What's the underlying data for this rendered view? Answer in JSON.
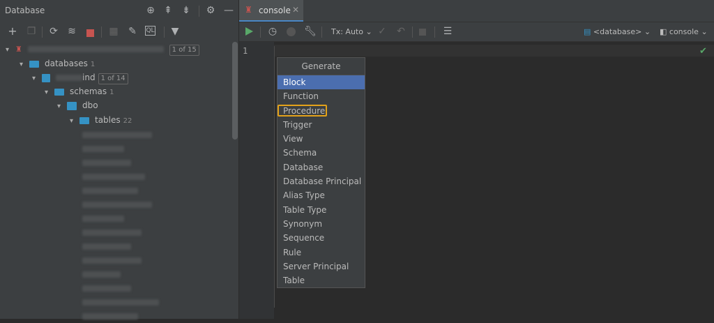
{
  "left_panel": {
    "title": "Database",
    "tree": {
      "root_badge": "1 of 15",
      "databases_label": "databases",
      "databases_count": "1",
      "db_name_visible": "ind",
      "db_badge": "1 of 14",
      "schemas_label": "schemas",
      "schemas_count": "1",
      "schema_name": "dbo",
      "tables_label": "tables",
      "tables_count": "22"
    }
  },
  "editor": {
    "tab_label": "console",
    "tx_mode": "Tx: Auto",
    "database_selector": "<database>",
    "session_selector": "console",
    "line_number": "1"
  },
  "popup": {
    "title": "Generate",
    "items": [
      "Block",
      "Function",
      "Procedure",
      "Trigger",
      "View",
      "Schema",
      "Database",
      "Database Principal",
      "Alias Type",
      "Table Type",
      "Synonym",
      "Sequence",
      "Rule",
      "Server Principal",
      "Table"
    ],
    "selected": "Block",
    "highlighted": "Procedure"
  },
  "colors": {
    "selection": "#4b6eaf",
    "highlight_box": "#e3a21a",
    "run_green": "#59a869",
    "stop_red": "#c75450",
    "folder_blue": "#3592c4"
  }
}
